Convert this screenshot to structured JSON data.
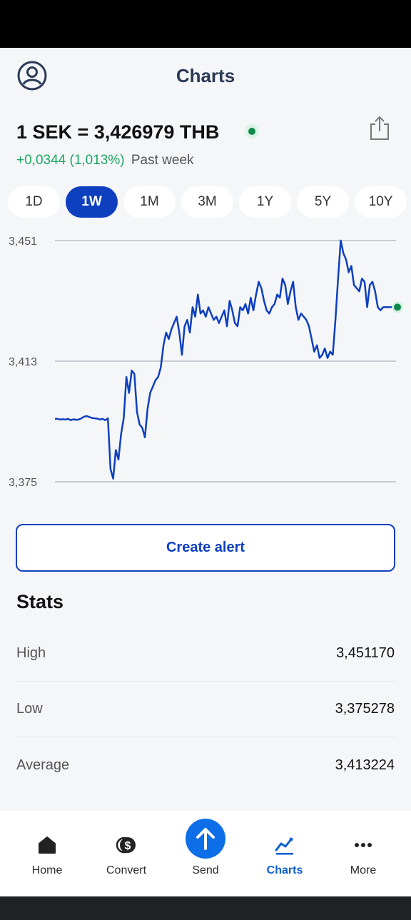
{
  "header": {
    "title": "Charts"
  },
  "rate": {
    "text": "1 SEK = 3,426979 THB",
    "change": "+0,0344 (1,013%)",
    "period": "Past week"
  },
  "ranges": [
    "1D",
    "1W",
    "1M",
    "3M",
    "1Y",
    "5Y",
    "10Y"
  ],
  "active_range": "1W",
  "chart_data": {
    "type": "line",
    "y_ticks": [
      "3,451",
      "3,413",
      "3,375"
    ],
    "ylim": [
      3.375,
      3.451
    ],
    "series": [
      {
        "color": "#0d3fbf",
        "values": [
          3.3948,
          3.3948,
          3.3946,
          3.3947,
          3.3946,
          3.3948,
          3.3944,
          3.3947,
          3.3945,
          3.3946,
          3.395,
          3.3955,
          3.3957,
          3.3954,
          3.3951,
          3.395,
          3.3949,
          3.3946,
          3.3948,
          3.3944,
          3.395,
          3.379,
          3.376,
          3.385,
          3.382,
          3.39,
          3.395,
          3.408,
          3.403,
          3.41,
          3.409,
          3.397,
          3.393,
          3.392,
          3.389,
          3.398,
          3.403,
          3.405,
          3.407,
          3.408,
          3.411,
          3.418,
          3.422,
          3.42,
          3.423,
          3.425,
          3.427,
          3.422,
          3.415,
          3.424,
          3.426,
          3.422,
          3.43,
          3.427,
          3.434,
          3.428,
          3.429,
          3.427,
          3.43,
          3.428,
          3.426,
          3.427,
          3.425,
          3.427,
          3.429,
          3.424,
          3.432,
          3.429,
          3.425,
          3.424,
          3.43,
          3.429,
          3.431,
          3.428,
          3.433,
          3.429,
          3.434,
          3.438,
          3.436,
          3.432,
          3.429,
          3.428,
          3.43,
          3.431,
          3.434,
          3.433,
          3.439,
          3.437,
          3.431,
          3.435,
          3.438,
          3.43,
          3.426,
          3.428,
          3.427,
          3.426,
          3.424,
          3.42,
          3.416,
          3.418,
          3.414,
          3.415,
          3.417,
          3.414,
          3.416,
          3.415,
          3.426,
          3.439,
          3.451,
          3.447,
          3.445,
          3.441,
          3.443,
          3.437,
          3.436,
          3.435,
          3.439,
          3.438,
          3.43,
          3.437,
          3.438,
          3.435,
          3.43,
          3.429,
          3.43,
          3.43,
          3.43,
          3.43
        ]
      }
    ]
  },
  "alert_button": "Create alert",
  "stats": {
    "title": "Stats",
    "rows": [
      {
        "label": "High",
        "value": "3,451170"
      },
      {
        "label": "Low",
        "value": "3,375278"
      },
      {
        "label": "Average",
        "value": "3,413224"
      }
    ]
  },
  "nav": [
    {
      "label": "Home",
      "icon": "home-icon"
    },
    {
      "label": "Convert",
      "icon": "convert-dollar-icon"
    },
    {
      "label": "Send",
      "icon": "send-arrow-icon"
    },
    {
      "label": "Charts",
      "icon": "charts-icon"
    },
    {
      "label": "More",
      "icon": "more-dots-icon"
    }
  ],
  "active_nav": "Charts"
}
